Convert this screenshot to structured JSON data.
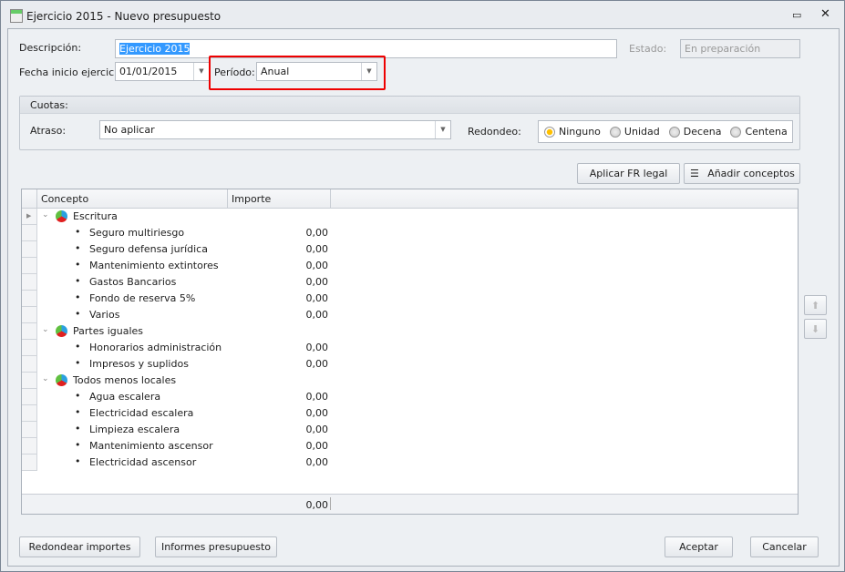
{
  "window": {
    "title": "Ejercicio 2015 - Nuevo presupuesto"
  },
  "form": {
    "descripcion_label": "Descripción:",
    "descripcion_value": "Ejercicio 2015",
    "estado_label": "Estado:",
    "estado_value": "En preparación",
    "fecha_label": "Fecha inicio ejercicio:",
    "fecha_value": "01/01/2015",
    "periodo_label": "Período:",
    "periodo_value": "Anual"
  },
  "cuotas": {
    "title": "Cuotas:",
    "atraso_label": "Atraso:",
    "atraso_value": "No aplicar",
    "redondeo_label": "Redondeo:",
    "options": [
      "Ninguno",
      "Unidad",
      "Decena",
      "Centena"
    ],
    "selected": "Ninguno"
  },
  "toolbar": {
    "aplicar": "Aplicar FR legal",
    "anadir": "Añadir conceptos"
  },
  "grid": {
    "columns": [
      "Concepto",
      "Importe"
    ],
    "total": "0,00",
    "rows": [
      {
        "type": "group",
        "label": "Escritura"
      },
      {
        "type": "item",
        "label": "Seguro multiriesgo",
        "value": "0,00"
      },
      {
        "type": "item",
        "label": "Seguro defensa jurídica",
        "value": "0,00"
      },
      {
        "type": "item",
        "label": "Mantenimiento extintores",
        "value": "0,00"
      },
      {
        "type": "item",
        "label": "Gastos Bancarios",
        "value": "0,00"
      },
      {
        "type": "item",
        "label": "Fondo de reserva 5%",
        "value": "0,00"
      },
      {
        "type": "item",
        "label": "Varios",
        "value": "0,00"
      },
      {
        "type": "group",
        "label": "Partes iguales"
      },
      {
        "type": "item",
        "label": "Honorarios administración",
        "value": "0,00"
      },
      {
        "type": "item",
        "label": "Impresos y suplidos",
        "value": "0,00"
      },
      {
        "type": "group",
        "label": "Todos menos locales"
      },
      {
        "type": "item",
        "label": "Agua escalera",
        "value": "0,00"
      },
      {
        "type": "item",
        "label": "Electricidad escalera",
        "value": "0,00"
      },
      {
        "type": "item",
        "label": "Limpieza escalera",
        "value": "0,00"
      },
      {
        "type": "item",
        "label": "Mantenimiento ascensor",
        "value": "0,00"
      },
      {
        "type": "item",
        "label": "Electricidad ascensor",
        "value": "0,00"
      }
    ]
  },
  "footer": {
    "redondear": "Redondear importes",
    "informes": "Informes presupuesto",
    "aceptar": "Aceptar",
    "cancelar": "Cancelar"
  }
}
